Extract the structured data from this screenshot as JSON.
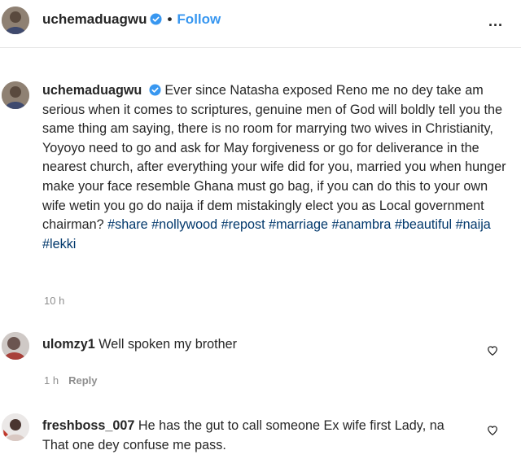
{
  "header": {
    "username": "uchemaduagwu",
    "separator": "•",
    "follow_label": "Follow",
    "more_label": "..."
  },
  "caption": {
    "username": "uchemaduagwu",
    "text": "Ever since Natasha exposed Reno me no dey take am serious when it comes to scriptures, genuine men of God will boldly tell you the same thing am saying, there is no room for marrying two wives in Christianity, Yoyoyo need to go and ask for May forgiveness or go for deliverance in the nearest church, after everything your wife did for you, married you when hunger make your face resemble Ghana must go bag, if you can do this to your own wife wetin you go do naija if dem mistakingly elect you as Local government chairman?",
    "hashtags": [
      "#share",
      "#nollywood",
      "#repost",
      "#marriage",
      "#anambra",
      "#beautiful",
      "#naija",
      "#lekki"
    ],
    "time": "10 h"
  },
  "comments": [
    {
      "username": "ulomzy1",
      "text": "Well spoken my brother",
      "time": "1 h",
      "reply_label": "Reply"
    },
    {
      "username": "freshboss_007",
      "text": "He has the gut to call someone Ex wife first Lady, na That one dey confuse me pass."
    }
  ],
  "colors": {
    "text": "#262626",
    "muted": "#8e8e8e",
    "link_blue": "#3897f0",
    "hashtag": "#00376b",
    "verified": "#3897f0"
  },
  "icons": {
    "verified": "verified-badge-icon",
    "heart": "heart-outline-icon",
    "more": "more-options-icon"
  }
}
